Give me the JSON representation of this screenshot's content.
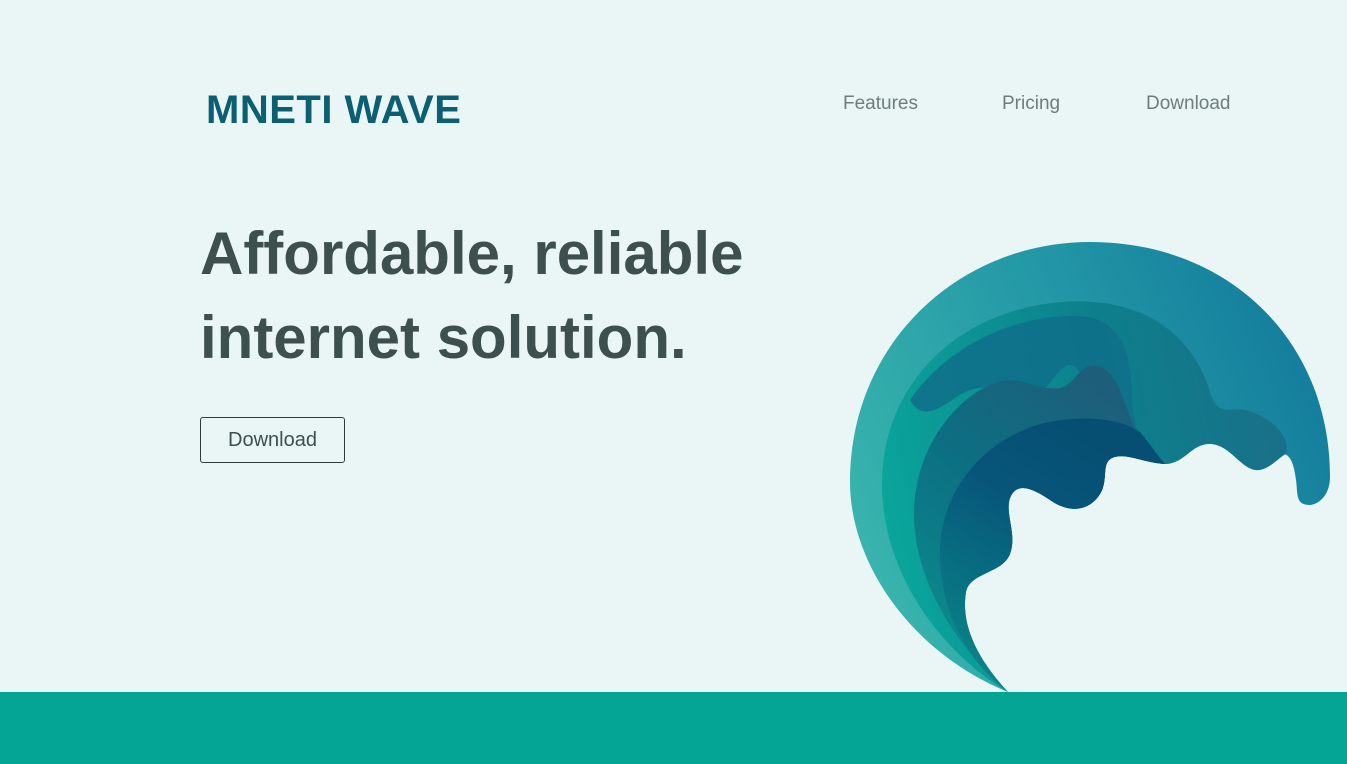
{
  "brand": {
    "name": "MNETI WAVE"
  },
  "nav": {
    "items": [
      {
        "label": "Features"
      },
      {
        "label": "Pricing"
      },
      {
        "label": "Download"
      }
    ]
  },
  "hero": {
    "title_line1": "Affordable, reliable",
    "title_line2": "internet solution.",
    "button_label": "Download"
  },
  "colors": {
    "background": "#eaf6f6",
    "brand": "#0b5f73",
    "heading": "#3d4f4e",
    "nav_text": "#6e7c7c",
    "footer_band": "#04a595",
    "wave_light": "#36b2ac",
    "wave_dark": "#0e5f7e"
  },
  "illustration": {
    "icon": "wave-illustration"
  }
}
